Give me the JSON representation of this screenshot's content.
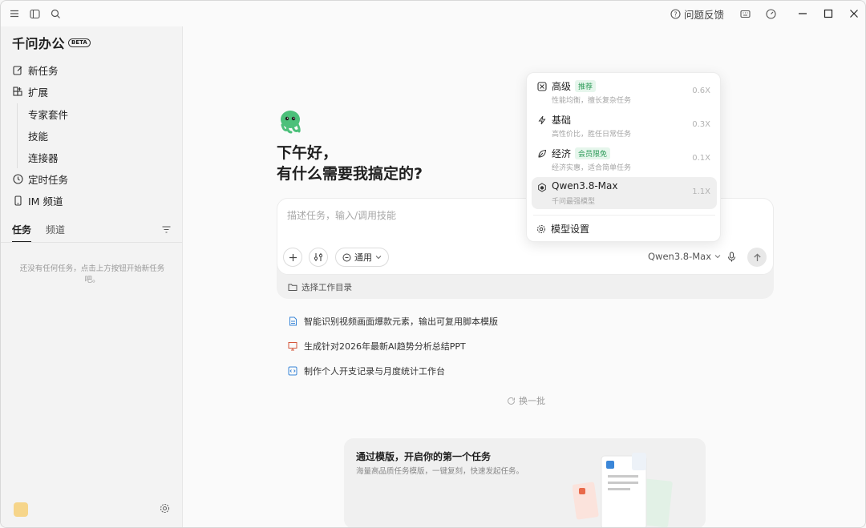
{
  "titlebar": {
    "feedback_label": "问题反馈"
  },
  "sidebar": {
    "brand_name": "千问办公",
    "brand_badge": "BETA",
    "nav": {
      "new_task": "新任务",
      "extensions": "扩展",
      "expert_suite": "专家套件",
      "skills": "技能",
      "connectors": "连接器",
      "scheduled": "定时任务",
      "im_channel": "IM 频道"
    },
    "tabs": {
      "tasks": "任务",
      "channels": "频道"
    },
    "empty_text": "还没有任何任务，点击上方按钮开始新任务吧。"
  },
  "main": {
    "greeting_line1": "下午好，",
    "greeting_line2": "有什么需要我搞定的?",
    "composer": {
      "placeholder": "描述任务，输入/调用技能",
      "mode_label": "通用",
      "model_label": "Qwen3.8-Max",
      "workdir_label": "选择工作目录"
    },
    "suggestions": [
      "智能识别视频画面爆款元素，输出可复用脚本模版",
      "生成针对2026年最新AI趋势分析总结PPT",
      "制作个人开支记录与月度统计工作台"
    ],
    "refresh_label": "换一批",
    "template_card": {
      "title": "通过模版，开启你的第一个任务",
      "subtitle": "海量高品质任务模版，一键复刻，快速发起任务。"
    }
  },
  "model_dropdown": {
    "options": [
      {
        "name": "高级",
        "tag": "推荐",
        "desc": "性能均衡，擅长复杂任务",
        "mult": "0.6X"
      },
      {
        "name": "基础",
        "tag": "",
        "desc": "高性价比，胜任日常任务",
        "mult": "0.3X"
      },
      {
        "name": "经济",
        "tag": "会员限免",
        "desc": "经济实惠，适合简单任务",
        "mult": "0.1X"
      },
      {
        "name": "Qwen3.8-Max",
        "tag": "",
        "desc": "千问最强模型",
        "mult": "1.1X"
      }
    ],
    "settings_label": "模型设置"
  },
  "colors": {
    "accent_green": "#2c9a57",
    "background": "#fafafa",
    "sidebar": "#f3f3f3"
  }
}
